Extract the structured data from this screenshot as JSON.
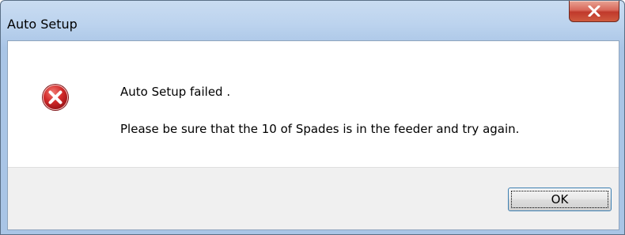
{
  "window": {
    "title": "Auto Setup",
    "close_button_label": "x"
  },
  "dialog": {
    "icon": "error-icon",
    "message_line1": "Auto Setup failed .",
    "message_line2": "Please be sure that the 10 of Spades is in the feeder and try again.",
    "ok_button_label": "OK"
  },
  "colors": {
    "titlebar": "#bcd3ee",
    "close_button": "#c9503d",
    "error_icon": "#c8202a",
    "footer": "#f0f0f0",
    "ok_button_border": "#3c7fb1"
  }
}
